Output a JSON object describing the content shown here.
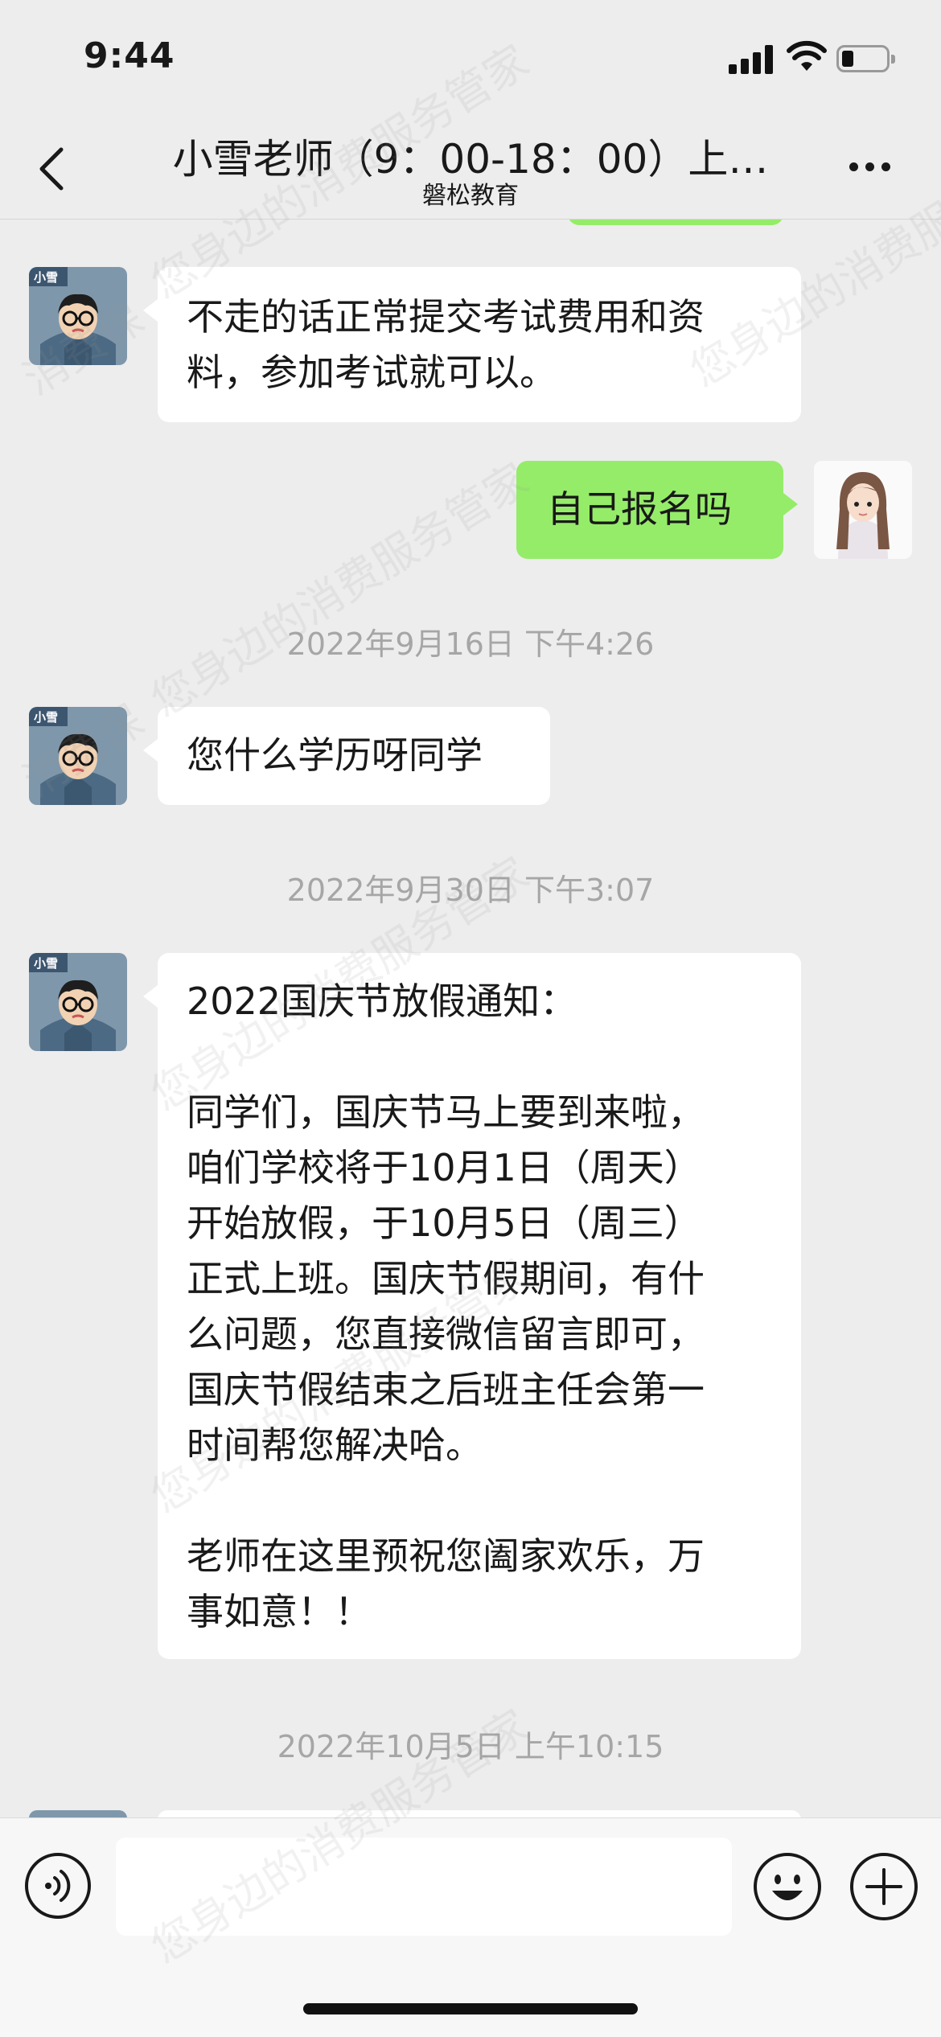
{
  "status_bar": {
    "time": "9:44"
  },
  "nav": {
    "title": "小雪老师（9：00-18：00）上…",
    "subtitle": "磐松教育"
  },
  "contact": {
    "avatar_label": "小雪"
  },
  "messages": [
    {
      "from": "them",
      "text": "不走的话正常提交考试费用和资\n料，参加考试就可以。"
    },
    {
      "from": "me",
      "text": "自己报名吗"
    },
    {
      "type": "timestamp",
      "text": "2022年9月16日 下午4:26"
    },
    {
      "from": "them",
      "text": "您什么学历呀同学"
    },
    {
      "type": "timestamp",
      "text": "2022年9月30日 下午3:07"
    },
    {
      "from": "them",
      "text": "2022国庆节放假通知：\n\n同学们，国庆节马上要到来啦，\n咱们学校将于10月1日（周天）\n开始放假，于10月5日（周三）\n正式上班。国庆节假期间，有什\n么问题，您直接微信留言即可，\n国庆节假结束之后班主任会第一\n时间帮您解决哈。\n\n老师在这里预祝您阖家欢乐，万\n事如意！！"
    },
    {
      "type": "timestamp",
      "text": "2022年10月5日 上午10:15"
    }
  ],
  "watermark": {
    "text_a": "您身边的消费服务管家",
    "text_b": "消费保"
  },
  "colors": {
    "background": "#ededed",
    "incoming_bubble": "#ffffff",
    "outgoing_bubble": "#95ec69",
    "timestamp": "#a6a6a6"
  },
  "icons": [
    "back-icon",
    "more-icon",
    "voice-icon",
    "emoji-icon",
    "plus-icon"
  ]
}
